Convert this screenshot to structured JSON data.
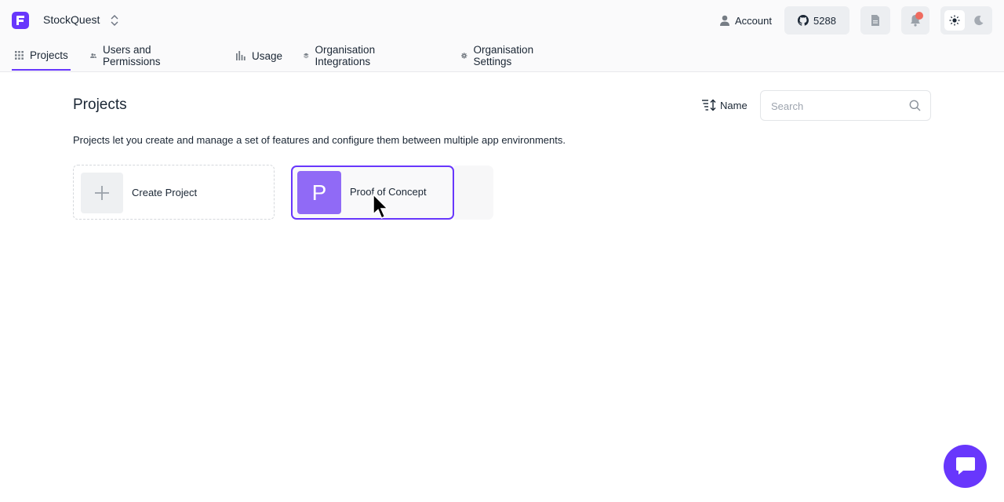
{
  "header": {
    "org_name": "StockQuest",
    "account_label": "Account",
    "github_stars": "5288",
    "icons": {
      "logo": "flagsmith-logo-icon",
      "switch": "chevron-up-down-icon",
      "account": "user-icon",
      "github": "github-icon",
      "docs": "document-icon",
      "notifications": "bell-icon",
      "light": "sun-icon",
      "dark": "moon-icon"
    }
  },
  "nav": {
    "tabs": [
      {
        "label": "Projects",
        "icon": "grid-icon",
        "active": true
      },
      {
        "label": "Users and Permissions",
        "icon": "users-icon"
      },
      {
        "label": "Usage",
        "icon": "bar-chart-icon"
      },
      {
        "label": "Organisation Integrations",
        "icon": "layers-icon"
      },
      {
        "label": "Organisation Settings",
        "icon": "gear-icon"
      }
    ]
  },
  "main": {
    "title": "Projects",
    "sort_label": "Name",
    "search_placeholder": "Search",
    "description": "Projects let you create and manage a set of features and configure them between multiple app environments.",
    "create_label": "Create Project",
    "projects": [
      {
        "initial": "P",
        "name": "Proof of Concept"
      }
    ]
  },
  "colors": {
    "accent": "#6837fc",
    "avatar": "#906af6",
    "notification_dot": "#ef6b5f"
  }
}
